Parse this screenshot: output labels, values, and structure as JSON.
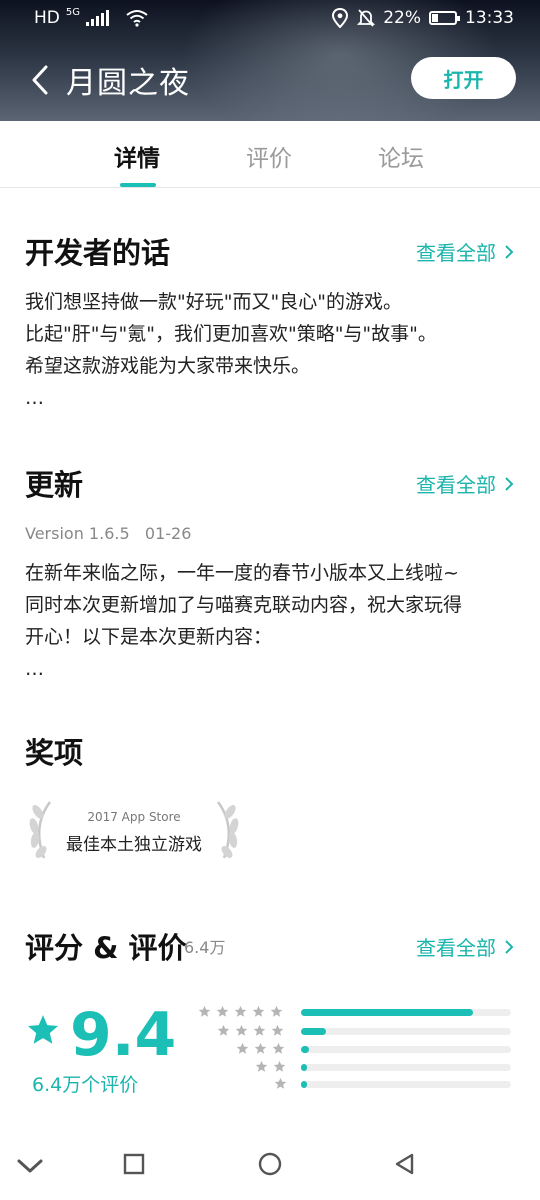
{
  "status": {
    "carrier": "HD",
    "network": "5G",
    "battery": "22%",
    "time": "13:33"
  },
  "header": {
    "title": "月圆之夜",
    "open_label": "打开"
  },
  "tabs": [
    {
      "label": "详情"
    },
    {
      "label": "评价"
    },
    {
      "label": "论坛"
    }
  ],
  "active_tab": "详情",
  "developer": {
    "title": "开发者的话",
    "more": "查看全部",
    "text": "我们想坚持做一款\"好玩\"而又\"良心\"的游戏。\n比起\"肝\"与\"氪\"，我们更加喜欢\"策略\"与\"故事\"。\n希望这款游戏能为大家带来快乐。\n…"
  },
  "update": {
    "title": "更新",
    "more": "查看全部",
    "version": "Version 1.6.5   01-26",
    "text": "在新年来临之际，一年一度的春节小版本又上线啦~\n同时本次更新增加了与喵赛克联动内容，祝大家玩得\n开心！以下是本次更新内容：\n…"
  },
  "awards": {
    "title": "奖项",
    "items": [
      {
        "year": "2017 App Store",
        "name": "最佳本土独立游戏"
      }
    ]
  },
  "ratings": {
    "title": "评分 & 评价",
    "count_small": "6.4万",
    "more": "查看全部",
    "score": "9.4",
    "total_label": "6.4万个评价",
    "distribution": [
      {
        "stars": 5,
        "fraction": 0.82
      },
      {
        "stars": 4,
        "fraction": 0.12
      },
      {
        "stars": 3,
        "fraction": 0.04
      },
      {
        "stars": 2,
        "fraction": 0.015
      },
      {
        "stars": 1,
        "fraction": 0.015
      }
    ]
  },
  "colors": {
    "accent": "#1cbfb5",
    "accent_text": "#1cb5ac"
  }
}
